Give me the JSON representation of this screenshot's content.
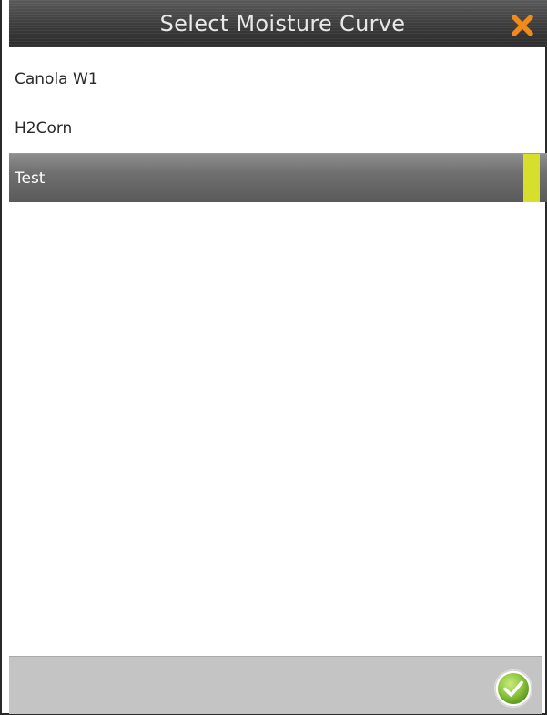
{
  "dialog": {
    "title": "Select Moisture Curve",
    "close_icon": "close-x-icon",
    "confirm_icon": "checkmark-circle-icon"
  },
  "curves": [
    {
      "label": "Canola W1",
      "selected": false
    },
    {
      "label": "H2Corn",
      "selected": false
    },
    {
      "label": "Test",
      "selected": true
    }
  ],
  "colors": {
    "accent_close": "#f08a1c",
    "selection_marker": "#d6df2b",
    "confirm_green": "#8cc63f"
  }
}
